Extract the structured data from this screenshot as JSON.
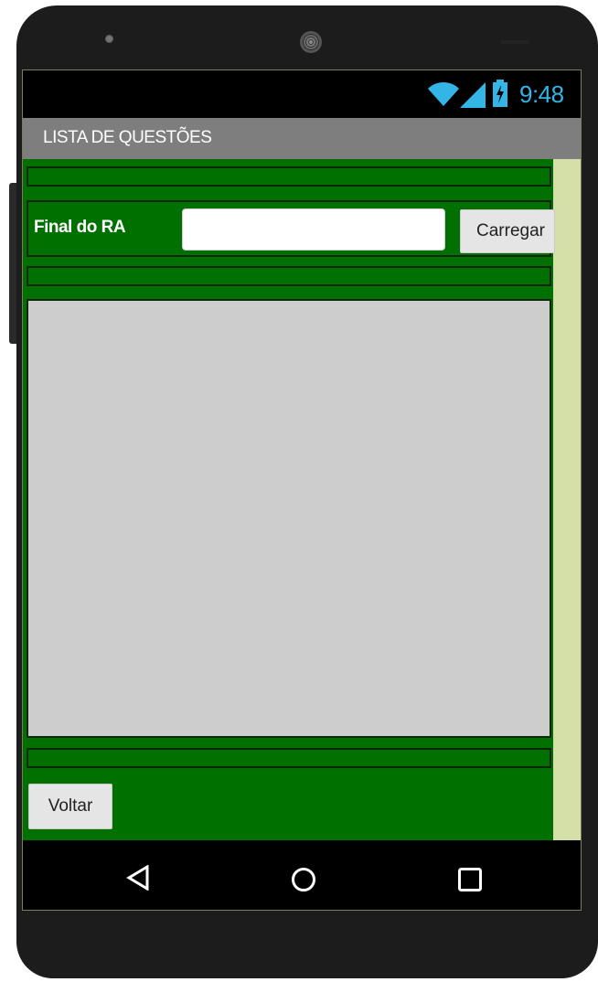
{
  "status_bar": {
    "time": "9:48",
    "icons": [
      "wifi-icon",
      "signal-icon",
      "battery-charging-icon"
    ],
    "clock_color": "#33b5e5"
  },
  "title_bar": {
    "title": "LISTA DE QUESTÕES"
  },
  "form": {
    "ra_label": "Final do RA",
    "ra_input_value": "",
    "ra_input_placeholder": "",
    "load_button_label": "Carregar"
  },
  "footer": {
    "back_button_label": "Voltar"
  },
  "nav_bar": {
    "icons": [
      "back-triangle-icon",
      "home-circle-icon",
      "recent-apps-square-icon"
    ]
  },
  "colors": {
    "panel_green": "#007000",
    "title_bar_gray": "#7e7e7e",
    "list_gray": "#cdcdcd",
    "side_strip": "#d4e0a8"
  }
}
